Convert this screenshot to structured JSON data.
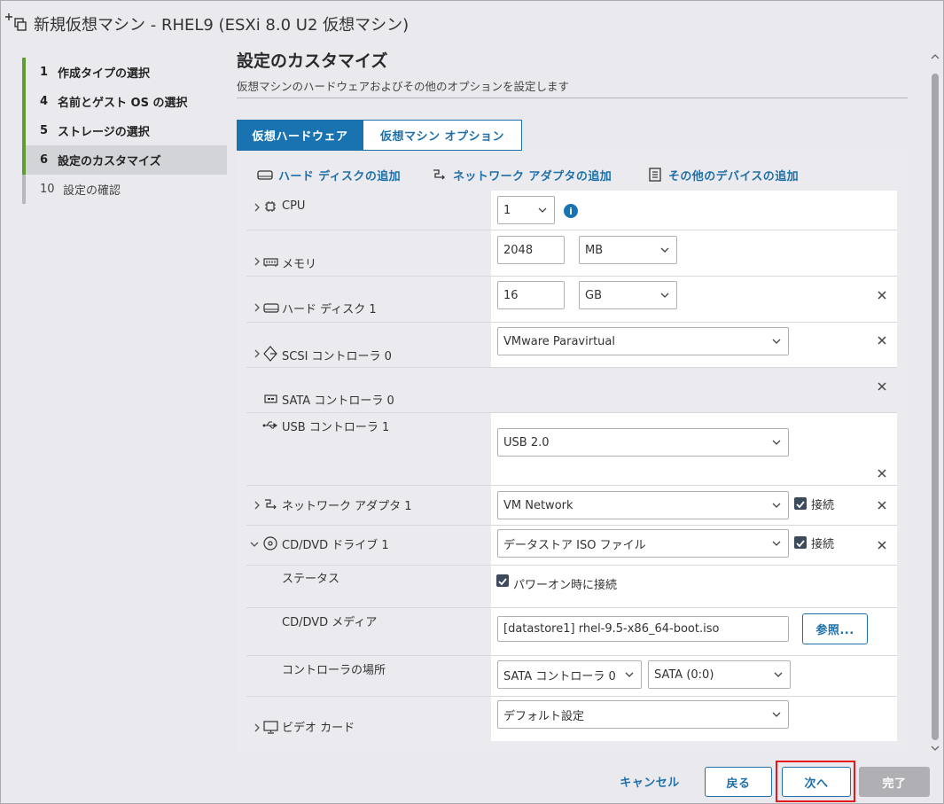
{
  "window": {
    "title": "新規仮想マシン - RHEL9 (ESXi 8.0 U2 仮想マシン)"
  },
  "steps": [
    {
      "num": "1",
      "label": "作成タイプの選択"
    },
    {
      "num": "4",
      "label": "名前とゲスト OS の選択"
    },
    {
      "num": "5",
      "label": "ストレージの選択"
    },
    {
      "num": "6",
      "label": "設定のカスタマイズ"
    },
    {
      "num": "10",
      "label": "設定の確認"
    }
  ],
  "page": {
    "title": "設定のカスタマイズ",
    "subtitle": "仮想マシンのハードウェアおよびその他のオプションを設定します"
  },
  "tabs": [
    {
      "label": "仮想ハードウェア"
    },
    {
      "label": "仮想マシン オプション"
    }
  ],
  "actions": {
    "add_disk": "ハード ディスクの追加",
    "add_network": "ネットワーク アダプタの追加",
    "add_other": "その他のデバイスの追加"
  },
  "hardware": {
    "cpu": {
      "label": "CPU",
      "value": "1"
    },
    "memory": {
      "label": "メモリ",
      "value": "2048",
      "unit": "MB"
    },
    "disk": {
      "label": "ハード ディスク 1",
      "value": "16",
      "unit": "GB"
    },
    "scsi": {
      "label": "SCSI コントローラ 0",
      "value": "VMware Paravirtual"
    },
    "sata": {
      "label": "SATA コントローラ 0"
    },
    "usb": {
      "label": "USB コントローラ 1",
      "value": "USB 2.0"
    },
    "network": {
      "label": "ネットワーク アダプタ 1",
      "value": "VM Network",
      "connect_label": "接続"
    },
    "cdrom": {
      "label": "CD/DVD ドライブ 1",
      "value": "データストア ISO ファイル",
      "connect_label": "接続",
      "status_label": "ステータス",
      "power_on_label": "パワーオン時に接続",
      "media_label": "CD/DVD メディア",
      "media_value": "[datastore1] rhel-9.5-x86_64-boot.iso",
      "browse_label": "参照...",
      "location_label": "コントローラの場所",
      "controller_value": "SATA コントローラ 0",
      "slot_value": "SATA (0:0)"
    },
    "video": {
      "label": "ビデオ カード",
      "value": "デフォルト設定"
    }
  },
  "footer": {
    "cancel": "キャンセル",
    "back": "戻る",
    "next": "次へ",
    "finish": "完了"
  },
  "colors": {
    "accent": "#1a73b1",
    "step_done": "#5f9c31",
    "highlight": "#e5151c"
  }
}
